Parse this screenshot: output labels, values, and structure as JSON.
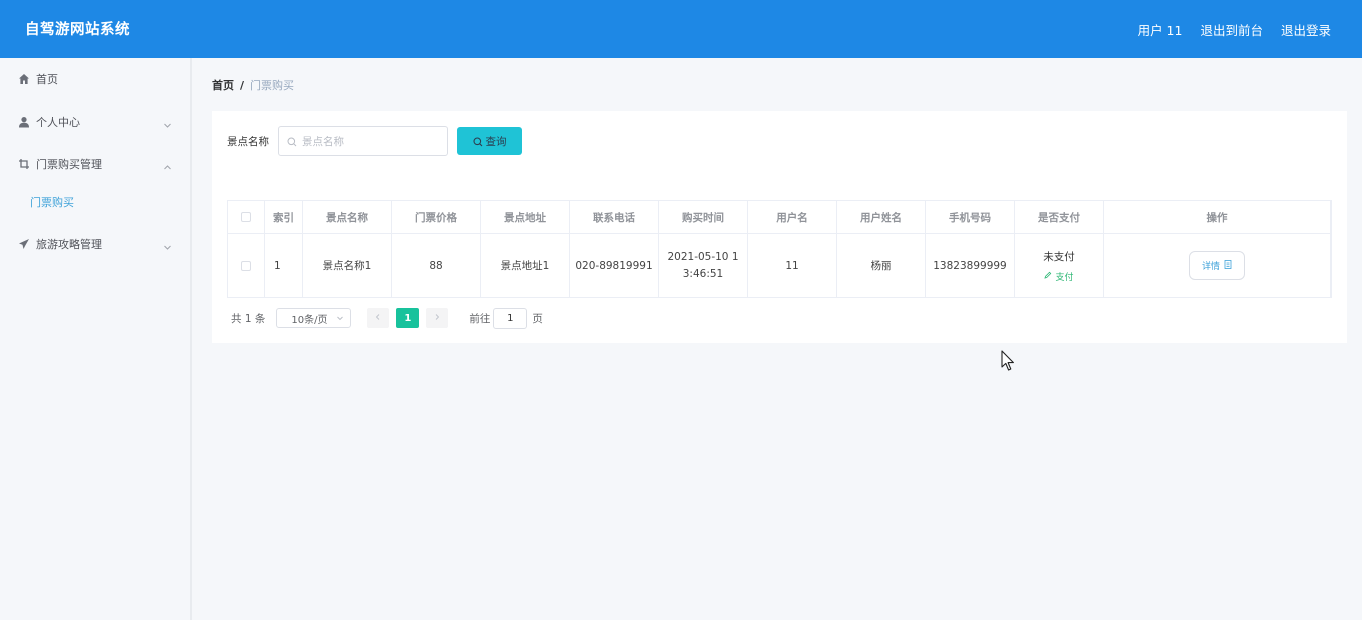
{
  "header": {
    "title": "自驾游网站系统",
    "user_label": "用户 11",
    "front_label": "退出到前台",
    "logout_label": "退出登录"
  },
  "sidebar": {
    "items": [
      {
        "label": "首页",
        "icon": "home-icon"
      },
      {
        "label": "个人中心",
        "icon": "user-icon"
      },
      {
        "label": "门票购买管理",
        "icon": "crop-icon"
      },
      {
        "label": "旅游攻略管理",
        "icon": "send-icon"
      }
    ],
    "sub_item": "门票购买"
  },
  "breadcrumb": {
    "home": "首页",
    "separator": "/",
    "current": "门票购买"
  },
  "search": {
    "label": "景点名称",
    "placeholder": "景点名称",
    "button": "查询"
  },
  "table": {
    "headers": [
      "索引",
      "景点名称",
      "门票价格",
      "景点地址",
      "联系电话",
      "购买时间",
      "用户名",
      "用户姓名",
      "手机号码",
      "是否支付",
      "操作"
    ],
    "rows": [
      {
        "index": "1",
        "name": "景点名称1",
        "price": "88",
        "address": "景点地址1",
        "phone": "020-89819991",
        "time_line1": "2021-05-10 1",
        "time_line2": "3:46:51",
        "username": "11",
        "realname": "杨丽",
        "mobile": "13823899999",
        "pay_status": "未支付",
        "pay_action": "支付",
        "detail": "详情"
      }
    ]
  },
  "pagination": {
    "total": "共 1 条",
    "page_size": "10条/页",
    "current_page": "1",
    "goto_label": "前往",
    "goto_value": "1",
    "goto_unit": "页"
  },
  "colors": {
    "header_bg": "#1e88e5",
    "search_btn": "#1fc3d6",
    "active_page": "#18c29c",
    "link": "#3ea2d9",
    "pay": "#2bb673"
  }
}
